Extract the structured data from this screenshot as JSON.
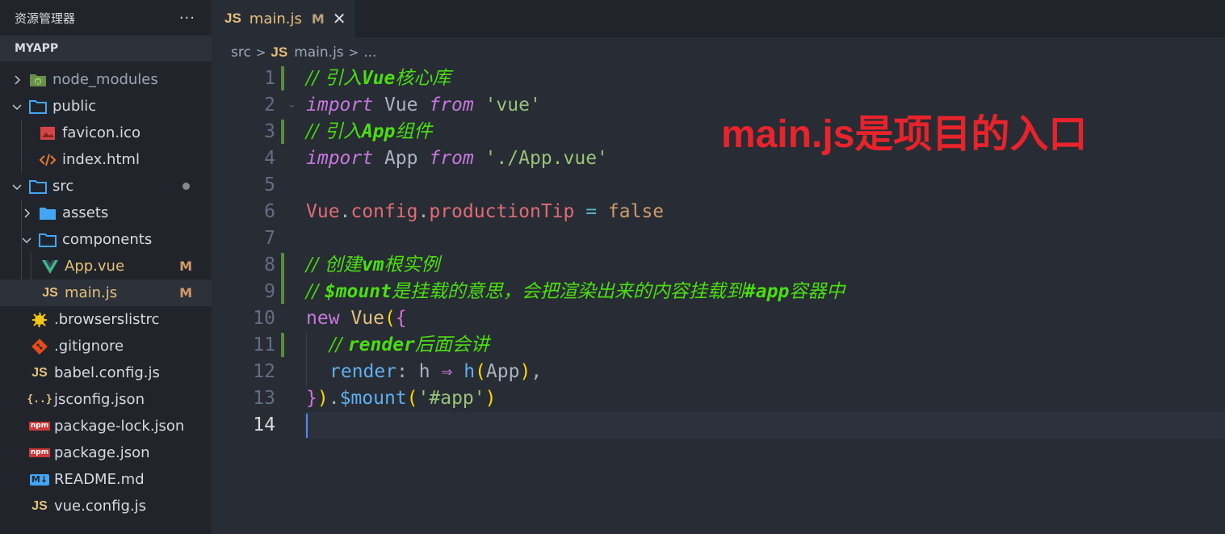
{
  "sidebar": {
    "title": "资源管理器",
    "more": "···",
    "project": "MYAPP",
    "items": [
      {
        "label": "node_modules",
        "icon": "node-folder-icon"
      },
      {
        "label": "public",
        "icon": "folder-icon"
      },
      {
        "label": "favicon.ico",
        "icon": "image-icon"
      },
      {
        "label": "index.html",
        "icon": "html-icon"
      },
      {
        "label": "src",
        "icon": "folder-icon"
      },
      {
        "label": "assets",
        "icon": "folder-icon"
      },
      {
        "label": "components",
        "icon": "folder-icon"
      },
      {
        "label": "App.vue",
        "icon": "vue-icon",
        "badge": "M"
      },
      {
        "label": "main.js",
        "icon": "js-icon",
        "badge": "M"
      },
      {
        "label": ".browserslistrc",
        "icon": "browserslist-icon"
      },
      {
        "label": ".gitignore",
        "icon": "git-icon"
      },
      {
        "label": "babel.config.js",
        "icon": "js-icon"
      },
      {
        "label": "jsconfig.json",
        "icon": "json-icon"
      },
      {
        "label": "package-lock.json",
        "icon": "npm-icon"
      },
      {
        "label": "package.json",
        "icon": "npm-icon"
      },
      {
        "label": "README.md",
        "icon": "markdown-icon"
      },
      {
        "label": "vue.config.js",
        "icon": "js-icon"
      }
    ]
  },
  "icons": {
    "js": "JS",
    "json": "{..}",
    "npm": "npm",
    "md": "M↓"
  },
  "tab": {
    "icon": "JS",
    "name": "main.js",
    "badge": "M",
    "close": "✕"
  },
  "breadcrumb": {
    "folder": "src",
    "file_icon": "JS",
    "file": "main.js",
    "ellipsis": "..."
  },
  "code": {
    "line_numbers": [
      "1",
      "2",
      "3",
      "4",
      "5",
      "6",
      "7",
      "8",
      "9",
      "10",
      "11",
      "12",
      "13",
      "14"
    ],
    "l1": {
      "a": "// ",
      "b": "引入",
      "c": "Vue",
      "d": "核心库"
    },
    "l2": {
      "kw": "import",
      "id": " Vue ",
      "from": "from",
      "str": " 'vue'"
    },
    "l3": {
      "a": "// ",
      "b": "引入",
      "c": "App",
      "d": "组件"
    },
    "l4": {
      "kw": "import",
      "id": " App ",
      "from": "from",
      "str": " './App.vue'"
    },
    "l6": {
      "obj": "Vue",
      "dot1": ".",
      "p1": "config",
      "dot2": ".",
      "p2": "productionTip",
      "eq": " = ",
      "val": "false"
    },
    "l8": {
      "a": "// ",
      "b": "创建",
      "c": "vm",
      "d": "根实例"
    },
    "l9": {
      "a": "// ",
      "c1": "$mount",
      "d1": "是挂载的意思，会把渲染出来的内容挂载到",
      "c2": "#app",
      "d2": "容器中"
    },
    "l10": {
      "kw": "new",
      "cls": " Vue",
      "p": "(",
      "b": "{"
    },
    "l11": {
      "a": "// ",
      "c": "render",
      "d": "后面会讲"
    },
    "l12": {
      "prop": "render",
      "colon": ": ",
      "h": "h",
      "arrow": " ⇒ ",
      "fn": "h",
      "p1": "(",
      "arg": "App",
      "p2": ")",
      "comma": ","
    },
    "l13": {
      "b": "}",
      "p": ")",
      "dot": ".",
      "fn": "$mount",
      "p1": "(",
      "str": "'#app'",
      "p2": ")"
    }
  },
  "annotation": "main.js是项目的入口",
  "colors": {
    "sidebar_bg": "#21252b",
    "editor_bg": "#282c34",
    "comment": "#4ade12",
    "keyword": "#c678dd",
    "string": "#98c379",
    "annotation": "#e8232b",
    "modified": "#d19a66"
  }
}
